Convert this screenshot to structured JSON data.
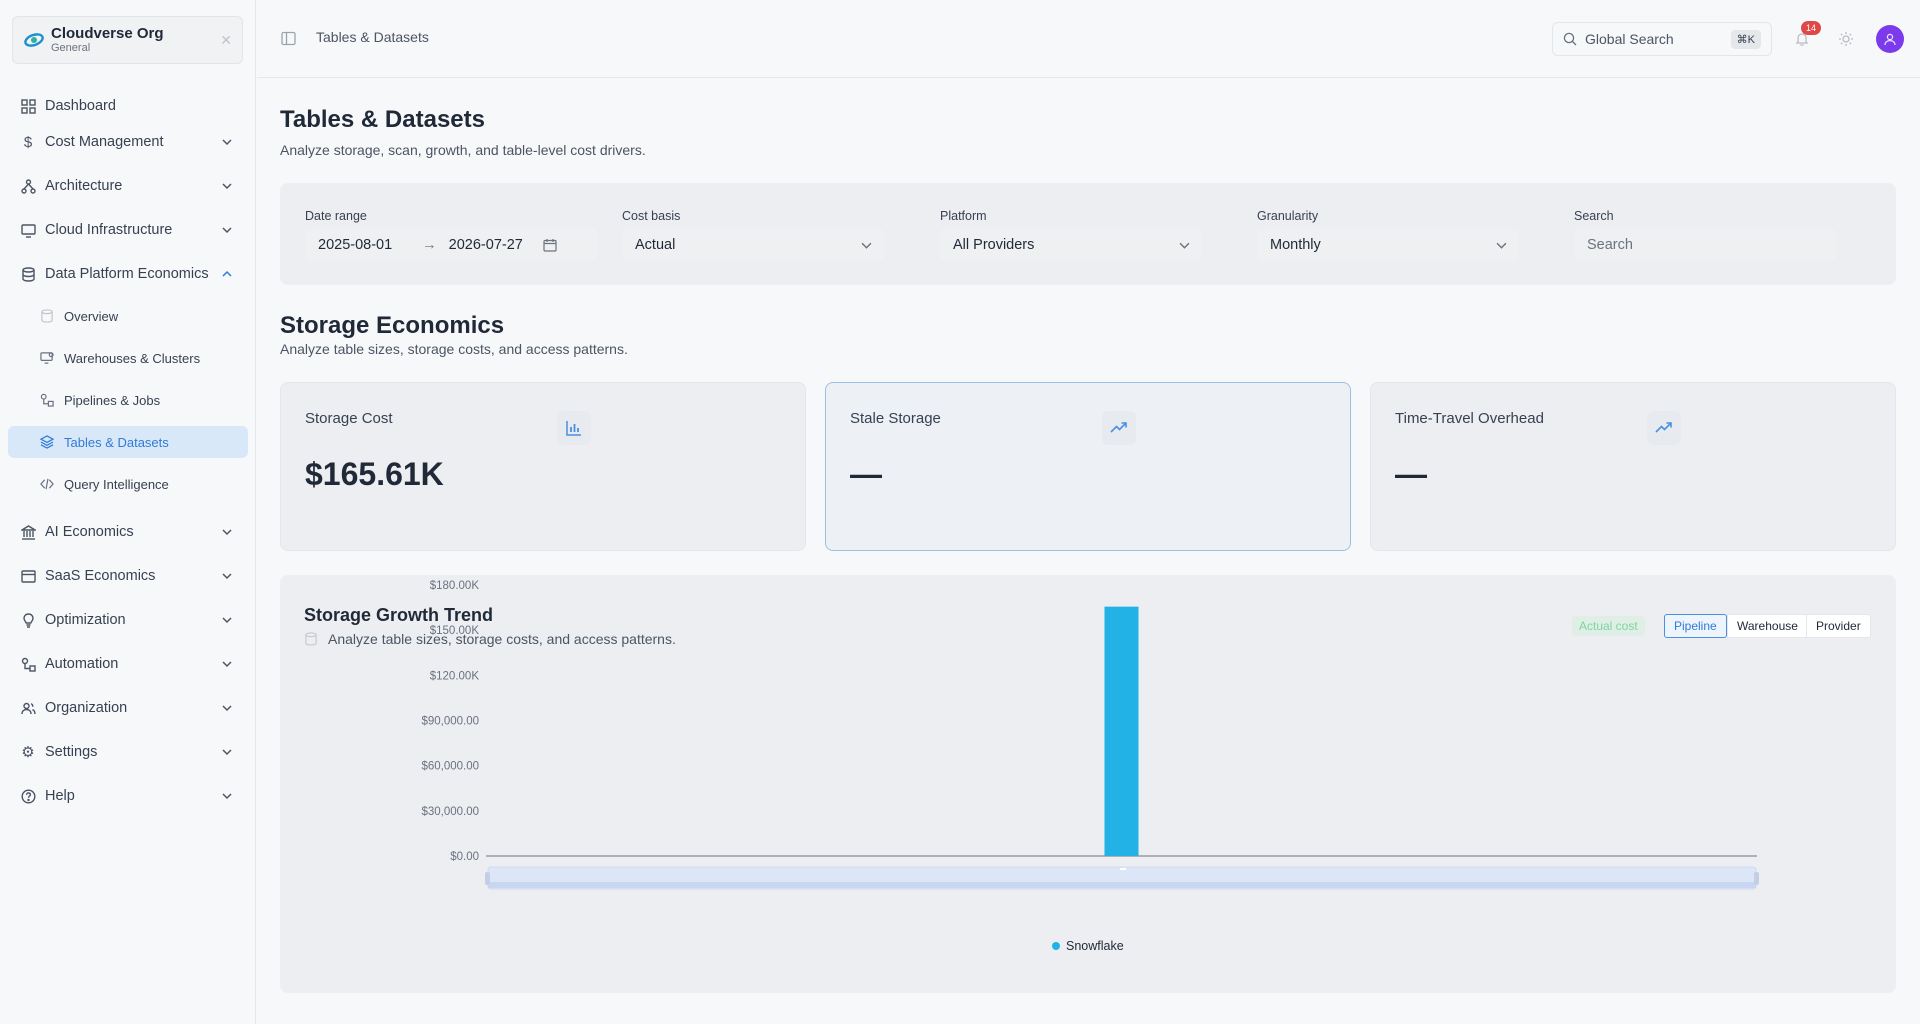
{
  "org": {
    "name": "Cloudverse Org",
    "workspace": "General"
  },
  "nav": {
    "dashboard": "Dashboard",
    "cost_management": "Cost Management",
    "architecture": "Architecture",
    "cloud_infrastructure": "Cloud Infrastructure",
    "data_platform_economics": "Data Platform Economics",
    "sub": {
      "overview": "Overview",
      "warehouses": "Warehouses & Clusters",
      "pipelines": "Pipelines & Jobs",
      "tables": "Tables & Datasets",
      "query": "Query Intelligence"
    },
    "ai_economics": "AI Economics",
    "saas_economics": "SaaS Economics",
    "optimization": "Optimization",
    "automation": "Automation",
    "organization": "Organization",
    "settings": "Settings",
    "help": "Help"
  },
  "header": {
    "breadcrumb": "Tables & Datasets",
    "search_placeholder": "Global Search",
    "shortcut": "⌘K",
    "notification_count": "14"
  },
  "page": {
    "title": "Tables & Datasets",
    "subtitle": "Analyze storage, scan, growth, and table-level cost drivers."
  },
  "filters": {
    "date_range_label": "Date range",
    "date_start": "2025-08-01",
    "date_arrow": "→",
    "date_end": "2026-07-27",
    "cost_basis_label": "Cost basis",
    "cost_basis_value": "Actual",
    "platform_label": "Platform",
    "platform_value": "All Providers",
    "granularity_label": "Granularity",
    "granularity_value": "Monthly",
    "search_label": "Search",
    "search_placeholder": "Search"
  },
  "storage": {
    "title": "Storage Economics",
    "subtitle": "Analyze table sizes, storage costs, and access patterns.",
    "cards": [
      {
        "label": "Storage Cost",
        "value": "$165.61K",
        "icon": "bar-chart-icon"
      },
      {
        "label": "Stale Storage",
        "value": "—",
        "icon": "trending-up-icon"
      },
      {
        "label": "Time-Travel Overhead",
        "value": "—",
        "icon": "trending-up-icon"
      }
    ]
  },
  "chart": {
    "title": "Storage Growth Trend",
    "subtitle": "Analyze table sizes, storage costs, and access patterns.",
    "actual_pill": "Actual cost",
    "segments": [
      "Pipeline",
      "Warehouse",
      "Provider"
    ],
    "active_segment": "Pipeline",
    "colors": {
      "series": "#22b2e6",
      "accent": "#2f7bd8"
    }
  },
  "chart_data": {
    "type": "bar",
    "categories": [
      ""
    ],
    "series": [
      {
        "name": "Snowflake",
        "values": [
          165610
        ]
      }
    ],
    "ytick_labels": [
      "$0.00",
      "$30,000.00",
      "$60,000.00",
      "$90,000.00",
      "$120.00K",
      "$150.00K",
      "$180.00K"
    ],
    "ylim": [
      0,
      180000
    ],
    "title": "Storage Growth Trend",
    "xlabel": "",
    "ylabel": "",
    "grid": false,
    "legend": "bottom-center"
  }
}
